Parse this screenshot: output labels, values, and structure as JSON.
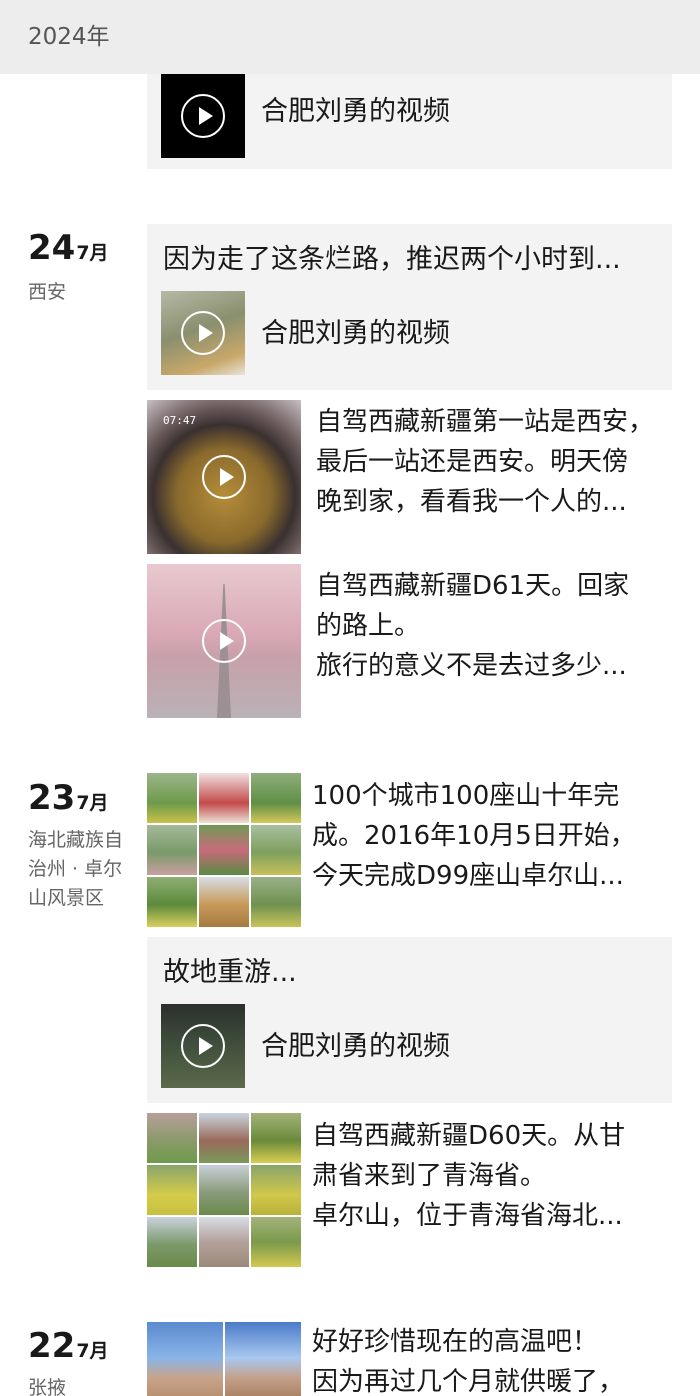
{
  "header": {
    "year": "2024年"
  },
  "colors": {
    "header_bg": "#ededed",
    "card_bg": "#f3f3f3",
    "text": "#191919",
    "muted": "#666666"
  },
  "entries": [
    {
      "cards": [
        {
          "video_label": "合肥刘勇的视频"
        }
      ]
    },
    {
      "day": "24",
      "month": "7月",
      "location": "西安",
      "share_card": {
        "title": "因为走了这条烂路，推迟两个小时到...",
        "video_label": "合肥刘勇的视频"
      },
      "posts": [
        {
          "thumb_text": "07:47",
          "lines": [
            "自驾西藏新疆第一站是西安，",
            "最后一站还是西安。明天傍",
            "晚到家，看看我一个人的..."
          ]
        },
        {
          "lines": [
            "自驾西藏新疆D61天。回家",
            "的路上。",
            "旅行的意义不是去过多少..."
          ]
        }
      ]
    },
    {
      "day": "23",
      "month": "7月",
      "location": "海北藏族自治州 · 卓尔山风景区",
      "posts": [
        {
          "lines": [
            "100个城市100座山十年完",
            "成。2016年10月5日开始，",
            "今天完成D99座山卓尔山..."
          ]
        }
      ],
      "share_card": {
        "title": "故地重游...",
        "video_label": "合肥刘勇的视频"
      },
      "posts2": [
        {
          "lines": [
            "自驾西藏新疆D60天。从甘",
            "肃省来到了青海省。",
            "卓尔山，位于青海省海北..."
          ]
        }
      ]
    },
    {
      "day": "22",
      "month": "7月",
      "location": "张掖",
      "posts": [
        {
          "lines": [
            "好好珍惜现在的高温吧！",
            "因为再过几个月就供暖了，"
          ]
        }
      ]
    }
  ]
}
